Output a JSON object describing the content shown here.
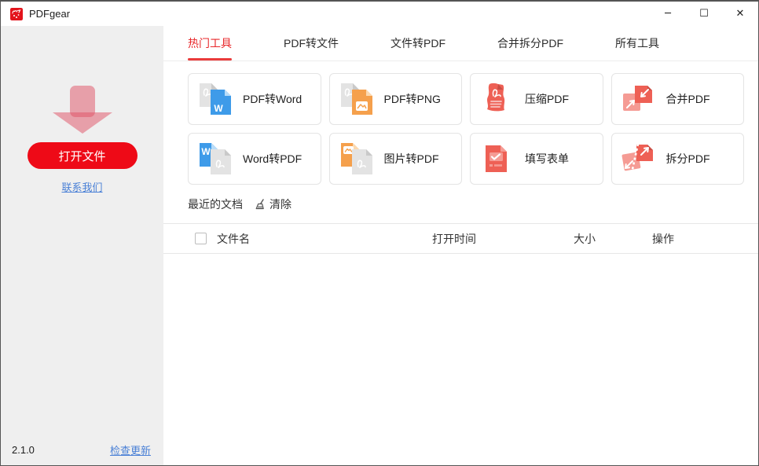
{
  "window": {
    "title": "PDFgear",
    "controls": {
      "minimize": "─",
      "maximize": "☐",
      "close": "✕"
    }
  },
  "sidebar": {
    "open_button": "打开文件",
    "contact_link": "联系我们",
    "version": "2.1.0",
    "check_update_link": "检查更新"
  },
  "tabs": [
    {
      "label": "热门工具",
      "active": true
    },
    {
      "label": "PDF转文件",
      "active": false
    },
    {
      "label": "文件转PDF",
      "active": false
    },
    {
      "label": "合并拆分PDF",
      "active": false
    },
    {
      "label": "所有工具",
      "active": false
    }
  ],
  "tools": [
    {
      "label": "PDF转Word",
      "icon": "pdf-to-word"
    },
    {
      "label": "PDF转PNG",
      "icon": "pdf-to-png"
    },
    {
      "label": "压缩PDF",
      "icon": "compress-pdf"
    },
    {
      "label": "合并PDF",
      "icon": "merge-pdf"
    },
    {
      "label": "Word转PDF",
      "icon": "word-to-pdf"
    },
    {
      "label": "图片转PDF",
      "icon": "image-to-pdf"
    },
    {
      "label": "填写表单",
      "icon": "fill-form"
    },
    {
      "label": "拆分PDF",
      "icon": "split-pdf"
    }
  ],
  "recent": {
    "title": "最近的文档",
    "clear_label": "清除",
    "columns": [
      "文件名",
      "打开时间",
      "大小",
      "操作"
    ],
    "rows": []
  },
  "colors": {
    "accent_red": "#EE0A17",
    "tab_red": "#E8282B",
    "link_blue": "#4A80D6",
    "word_blue": "#3E9BE9",
    "png_orange": "#F5A04C",
    "doc_gray": "#E3E3E3",
    "tool_red": "#EE6055",
    "tool_pink": "#F59B94",
    "sidebar_bg": "#EFEFEF"
  }
}
